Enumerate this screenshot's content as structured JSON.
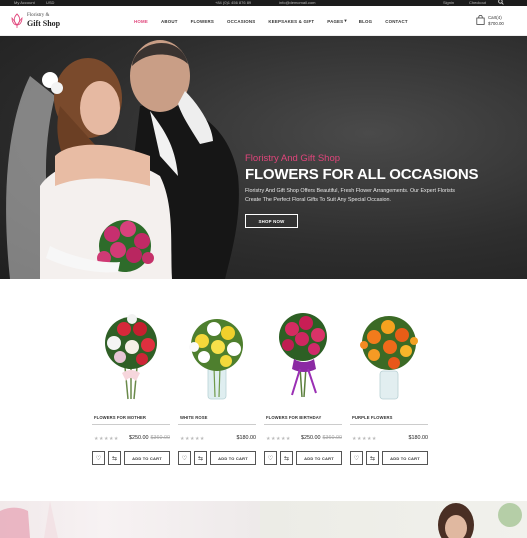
{
  "topbar": {
    "language": "My Account",
    "currency": "USD",
    "phone": "+84 (0)1 456 876 89",
    "email": "info@demomail.com",
    "signin": "Signin",
    "checkout": "Checkout"
  },
  "header": {
    "logo_line1": "Floristry &",
    "logo_line2": "Gift Shop",
    "nav": [
      "HOME",
      "ABOUT",
      "FLOWERS",
      "OCCASIONS",
      "KEEPSAKES & GIFT",
      "PAGES",
      "BLOG",
      "CONTACT"
    ],
    "pages_arrow": "▾",
    "cart_label": "Cart(4)",
    "cart_total": "$700.00"
  },
  "hero": {
    "subtitle": "Floristry And Gift Shop",
    "title": "FLOWERS FOR ALL OCCASIONS",
    "description": "Floristry And Gift Shop Offers Beautiful, Fresh Flower Arrangements. Our Expert Florists Create The Perfect Floral Gifts To Suit Any Special Occasion.",
    "button": "SHOP NOW"
  },
  "products": [
    {
      "name": "FLOWERS FOR MOTHER",
      "price": "$250.00",
      "old_price": "$360.00",
      "cart": "ADD TO CART",
      "stars": "★★★★★"
    },
    {
      "name": "WHITE ROSE",
      "price": "$180.00",
      "old_price": "",
      "cart": "ADD TO CART",
      "stars": "★★★★★"
    },
    {
      "name": "FLOWERS FOR BIRTHDAY",
      "price": "$250.00",
      "old_price": "$360.00",
      "cart": "ADD TO CART",
      "stars": "★★★★★"
    },
    {
      "name": "PURPLE FLOWERS",
      "price": "$180.00",
      "old_price": "",
      "cart": "ADD TO CART",
      "stars": "★★★★★"
    }
  ],
  "colors": {
    "accent": "#e0457b",
    "dark": "#1c1c1c"
  }
}
